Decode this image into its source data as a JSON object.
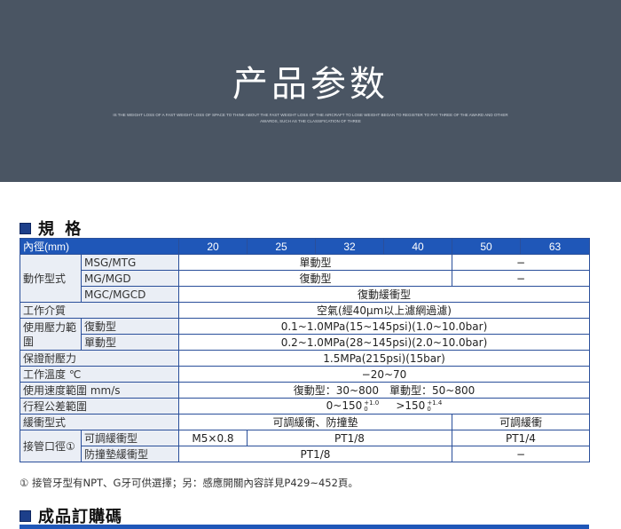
{
  "banner": {
    "title": "产品参数",
    "subtitle": "IS THE WEIGHT LOSS OF A FAST WEIGHT LOSS OF SPACE TO THINK ABOUT THE FAST WEIGHT LOSS OF THE AIRCRAFT TO LOSE WEIGHT BEGAN TO REGISTER TO PAY THREE OF THE AWARD AND OTHER AWARDS, SUCH AS THE CLASSIFICATION OF THREE",
    "background": "#4a5563"
  },
  "spec": {
    "heading": "規 格",
    "header": [
      "內徑(mm)",
      "20",
      "25",
      "32",
      "40",
      "50",
      "63"
    ],
    "action_label": "動作型式",
    "msg_name": "MSG/MTG",
    "msg_v1": "單動型",
    "msg_v2": "−",
    "mg_name": "MG/MGD",
    "mg_v1": "復動型",
    "mg_v2": "−",
    "mgc_name": "MGC/MGCD",
    "mgc_v": "復動緩衝型",
    "medium_label": "工作介質",
    "medium_v": "空氣(經40μm以上濾網過濾)",
    "pressure_label": "使用壓力範圍",
    "press_d_name": "復動型",
    "press_d_v": "0.1~1.0MPa(15~145psi)(1.0~10.0bar)",
    "press_s_name": "單動型",
    "press_s_v": "0.2~1.0MPa(28~145psi)(2.0~10.0bar)",
    "proof_label": "保證耐壓力",
    "proof_v": "1.5MPa(215psi)(15bar)",
    "temp_label": "工作溫度 ℃",
    "temp_v": "−20~70",
    "speed_label": "使用速度範圍 mm/s",
    "speed_v": "復動型：30~800　單動型：50~800",
    "stroke_label": "行程公差範圍",
    "stroke_a": "0~150",
    "stroke_a_sup": "+1.0",
    "stroke_a_sub": "0",
    "stroke_b": ">150",
    "stroke_b_sup": "+1.4",
    "stroke_b_sub": "0",
    "cushion_label": "緩衝型式",
    "cushion_v1": "可調緩衝、防撞墊",
    "cushion_v2": "可調緩衝",
    "port_label": "接管口徑①",
    "port_a_name": "可調緩衝型",
    "port_a_v1": "M5×0.8",
    "port_a_v2": "PT1/8",
    "port_a_v3": "PT1/4",
    "port_b_name": "防撞墊緩衝型",
    "port_b_v1": "PT1/8",
    "port_b_v2": "−",
    "note": "① 接管牙型有NPT、G牙可供選擇；另：感應開關內容詳見P429~452頁。",
    "accent": "#1f57b8"
  },
  "order": {
    "heading": "成品訂購碼"
  }
}
